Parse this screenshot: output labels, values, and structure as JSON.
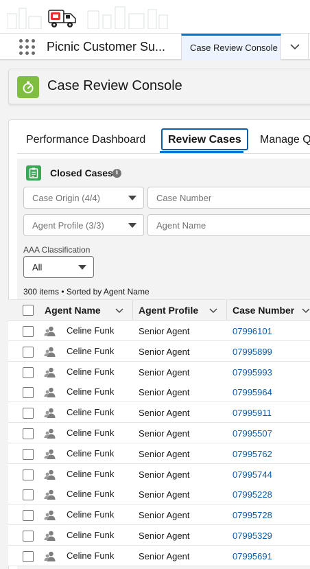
{
  "nav": {
    "app_name": "Picnic Customer Su...",
    "tab_label": "Case Review Console"
  },
  "page_header": {
    "title": "Case Review Console"
  },
  "tabs": [
    {
      "label": "Performance Dashboard"
    },
    {
      "label": "Review Cases"
    },
    {
      "label": "Manage Q"
    }
  ],
  "panel": {
    "title": "Closed Cases",
    "filters": {
      "case_origin": "Case Origin (4/4)",
      "case_number_placeholder": "Case Number",
      "agent_profile": "Agent Profile (3/3)",
      "agent_name_placeholder": "Agent Name"
    },
    "aaa_label": "AAA Classification",
    "aaa_value": "All",
    "count_text": "300 items • Sorted by Agent Name"
  },
  "table": {
    "columns": [
      "Agent Name",
      "Agent Profile",
      "Case Number"
    ],
    "rows": [
      {
        "agent_name": "Celine Funk",
        "agent_profile": "Senior Agent",
        "case_number": "07996101"
      },
      {
        "agent_name": "Celine Funk",
        "agent_profile": "Senior Agent",
        "case_number": "07995899"
      },
      {
        "agent_name": "Celine Funk",
        "agent_profile": "Senior Agent",
        "case_number": "07995993"
      },
      {
        "agent_name": "Celine Funk",
        "agent_profile": "Senior Agent",
        "case_number": "07995964"
      },
      {
        "agent_name": "Celine Funk",
        "agent_profile": "Senior Agent",
        "case_number": "07995911"
      },
      {
        "agent_name": "Celine Funk",
        "agent_profile": "Senior Agent",
        "case_number": "07995507"
      },
      {
        "agent_name": "Celine Funk",
        "agent_profile": "Senior Agent",
        "case_number": "07995762"
      },
      {
        "agent_name": "Celine Funk",
        "agent_profile": "Senior Agent",
        "case_number": "07995744"
      },
      {
        "agent_name": "Celine Funk",
        "agent_profile": "Senior Agent",
        "case_number": "07995228"
      },
      {
        "agent_name": "Celine Funk",
        "agent_profile": "Senior Agent",
        "case_number": "07995728"
      },
      {
        "agent_name": "Celine Funk",
        "agent_profile": "Senior Agent",
        "case_number": "07995329"
      },
      {
        "agent_name": "Celine Funk",
        "agent_profile": "Senior Agent",
        "case_number": "07995691"
      }
    ]
  },
  "icons": {
    "launcher": "app-launcher-icon",
    "truck": "delivery-truck-logo",
    "stopwatch": "stopwatch-icon",
    "cases": "cases-icon",
    "info": "info-icon",
    "agent": "agent-icon"
  },
  "colors": {
    "brand_blue": "#0176d3",
    "link_blue": "#0b5cab",
    "header_icon_green": "#7fbe41",
    "panel_icon_green": "#3ba755",
    "logo_red": "#e03131"
  }
}
